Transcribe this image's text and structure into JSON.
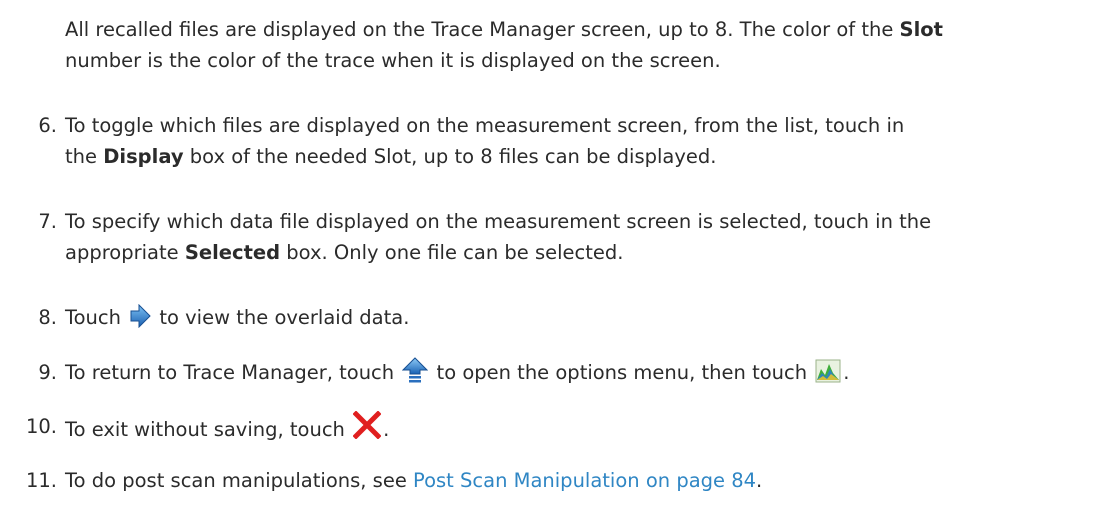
{
  "intro": {
    "line1_a": "All recalled files are displayed on the Trace Manager screen, up to 8. The color of the ",
    "line1_bold": "Slot",
    "line2": "number is the color of the trace when it is displayed on the screen."
  },
  "steps": [
    {
      "number": "6.",
      "line1": "To toggle which files are displayed on the measurement screen, from the list, touch in",
      "line2_a": "the ",
      "line2_bold": "Display",
      "line2_b": " box of the needed Slot, up to 8 files can be displayed."
    },
    {
      "number": "7.",
      "line1": "To specify which data file displayed on the measurement screen is selected, touch in the",
      "line2_a": "appropriate ",
      "line2_bold": "Selected",
      "line2_b": " box. Only one file can be selected."
    },
    {
      "number": "8.",
      "text_a": "Touch ",
      "text_b": " to view the overlaid data."
    },
    {
      "number": "9.",
      "text_a": "To return to Trace Manager, touch ",
      "text_b": " to open the options menu, then touch ",
      "text_c": "."
    },
    {
      "number": "10.",
      "text_a": "To exit without saving, touch ",
      "text_b": "."
    },
    {
      "number": "11.",
      "text_a": "To do post scan manipulations, see ",
      "link": "Post Scan Manipulation on page 84",
      "text_b": "."
    }
  ],
  "icons": {
    "step8": "blue-right-arrow-icon",
    "step9_first": "options-menu-up-arrow-icon",
    "step9_second": "trace-manager-chart-icon",
    "step10": "red-x-close-icon"
  },
  "colors": {
    "text": "#2b2b2b",
    "link": "#2f86c4",
    "arrow_blue": "#2a78c8",
    "close_red": "#e01f1f"
  }
}
